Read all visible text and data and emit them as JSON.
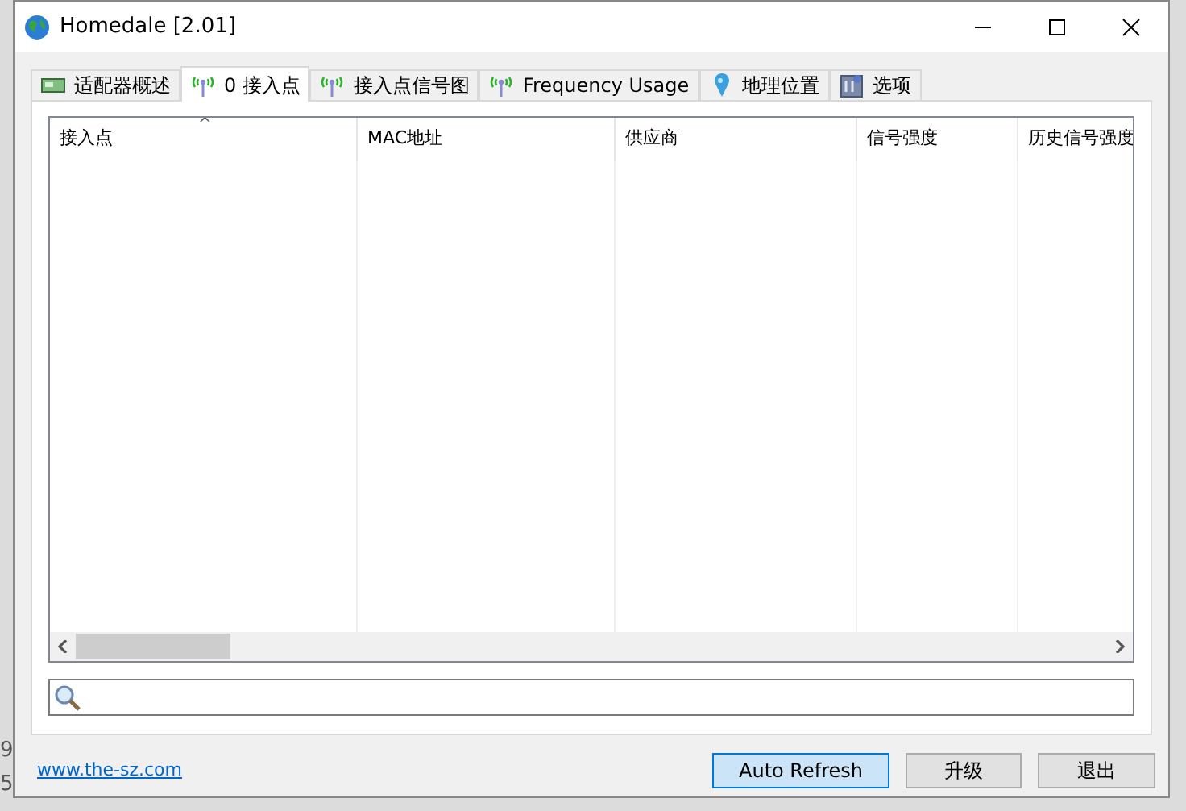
{
  "background_fragments": [
    "9",
    "5"
  ],
  "window": {
    "title": "Homedale [2.01]"
  },
  "tabs": [
    {
      "label": "适配器概述",
      "kind": "adapter",
      "selected": false
    },
    {
      "label": "0 接入点",
      "kind": "antenna",
      "selected": true
    },
    {
      "label": "接入点信号图",
      "kind": "antenna",
      "selected": false
    },
    {
      "label": "Frequency Usage",
      "kind": "antenna",
      "selected": false
    },
    {
      "label": "地理位置",
      "kind": "pin",
      "selected": false
    },
    {
      "label": "选项",
      "kind": "options",
      "selected": false
    }
  ],
  "table": {
    "sort_indicator": "^",
    "columns": [
      "接入点",
      "MAC地址",
      "供应商",
      "信号强度",
      "历史信号强度"
    ]
  },
  "link": "www.the-sz.com",
  "buttons": [
    {
      "label": "Auto Refresh",
      "highlighted": true
    },
    {
      "label": "升级",
      "highlighted": false
    },
    {
      "label": "退出",
      "highlighted": false
    }
  ]
}
